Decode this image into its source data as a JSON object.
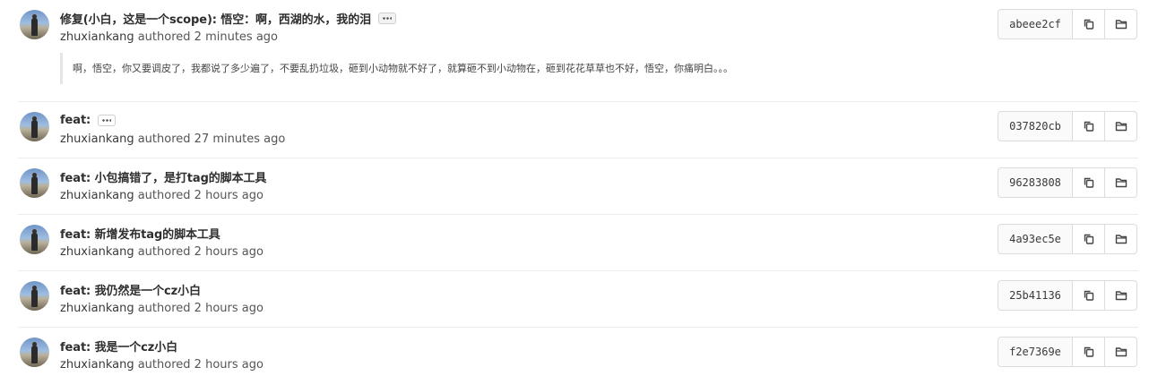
{
  "commits": [
    {
      "title": "修复(小白，这是一个scope): 悟空：啊，西湖的水，我的泪",
      "has_ellipsis": true,
      "author": "zhuxiankang",
      "authored_label": "authored",
      "time": "2 minutes ago",
      "description": "啊，悟空，你又要调皮了，我都说了多少遍了，不要乱扔垃圾，砸到小动物就不好了，就算砸不到小动物在，砸到花花草草也不好，悟空，你痛明白。。。",
      "sha": "abeee2cf"
    },
    {
      "title": "feat:",
      "has_ellipsis": true,
      "author": "zhuxiankang",
      "authored_label": "authored",
      "time": "27 minutes ago",
      "sha": "037820cb"
    },
    {
      "title": "feat: 小包搞错了，是打tag的脚本工具",
      "author": "zhuxiankang",
      "authored_label": "authored",
      "time": "2 hours ago",
      "sha": "96283808"
    },
    {
      "title": "feat: 新增发布tag的脚本工具",
      "author": "zhuxiankang",
      "authored_label": "authored",
      "time": "2 hours ago",
      "sha": "4a93ec5e"
    },
    {
      "title": "feat: 我仍然是一个cz小白",
      "author": "zhuxiankang",
      "authored_label": "authored",
      "time": "2 hours ago",
      "sha": "25b41136"
    },
    {
      "title": "feat: 我是一个cz小白",
      "author": "zhuxiankang",
      "authored_label": "authored",
      "time": "2 hours ago",
      "sha": "f2e7369e"
    }
  ],
  "icons": {
    "copy": "copy-icon",
    "browse": "folder-icon"
  },
  "colors": {
    "border": "#dcdcdc",
    "divider": "#ececec",
    "title": "#2e2e2e",
    "meta": "#555555"
  }
}
